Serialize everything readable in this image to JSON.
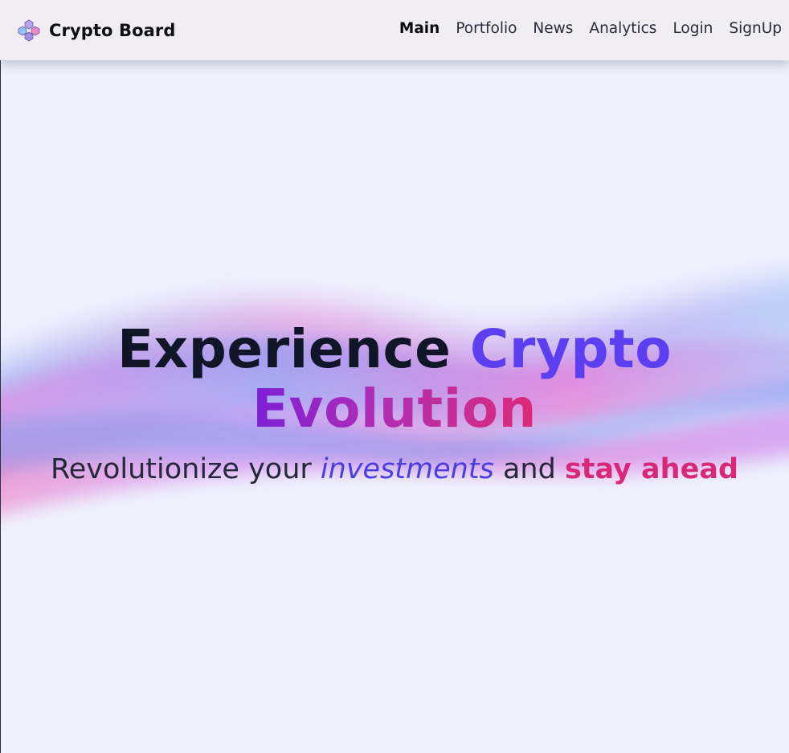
{
  "header": {
    "brand_name": "Crypto Board",
    "brand_icon": "cube-cluster-logo-icon",
    "nav": [
      {
        "label": "Main",
        "active": true
      },
      {
        "label": "Portfolio",
        "active": false
      },
      {
        "label": "News",
        "active": false
      },
      {
        "label": "Analytics",
        "active": false
      },
      {
        "label": "Login",
        "active": false
      },
      {
        "label": "SignUp",
        "active": false
      }
    ]
  },
  "hero": {
    "title_part1": "Experience",
    "title_part2": "Crypto",
    "title_part3": "Evolution",
    "subtitle_part1": "Revolutionize your",
    "subtitle_part2": "investments",
    "subtitle_part3": "and",
    "subtitle_part4": "stay ahead"
  },
  "colors": {
    "background": "#eef2fd",
    "header_bg": "#f1edf4",
    "title_dark": "#101628",
    "accent_blue": "#5b3ff0",
    "accent_purple": "#7d1fd6",
    "accent_pink": "#dd2a78"
  }
}
